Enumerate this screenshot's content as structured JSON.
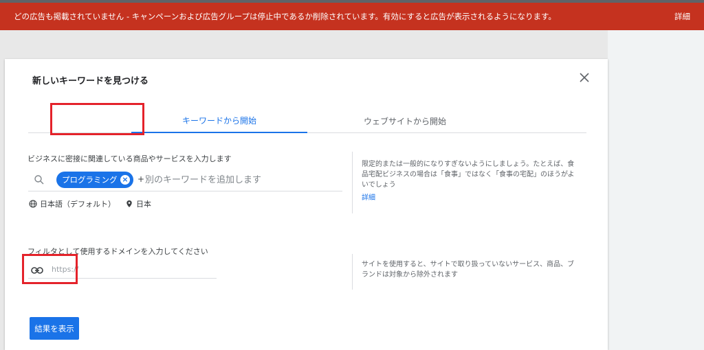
{
  "banner": {
    "message": "どの広告も掲載されていません - キャンペーンおよび広告グループは停止中であるか削除されています。有効にすると広告が表示されるようになります。",
    "details_label": "詳細"
  },
  "dialog": {
    "title": "新しいキーワードを見つける",
    "tabs": [
      {
        "label": "キーワードから開始",
        "active": true
      },
      {
        "label": "ウェブサイトから開始",
        "active": false
      }
    ],
    "keywords": {
      "label": "ビジネスに密接に関連している商品やサービスを入力します",
      "chip": "プログラミング",
      "plus": "+",
      "placeholder": "別のキーワードを追加します",
      "language": "日本語（デフォルト）",
      "location": "日本",
      "help_text": "限定的または一般的になりすぎないようにしましょう。たとえば、食品宅配ビジネスの場合は「食事」ではなく「食事の宅配」のほうがよいでしょう",
      "help_link": "詳細"
    },
    "domain": {
      "label": "フィルタとして使用するドメインを入力してください",
      "placeholder": "https://",
      "help_text": "サイトを使用すると、サイトで取り扱っていないサービス、商品、ブランドは対象から除外されます"
    },
    "submit_label": "結果を表示"
  },
  "colors": {
    "banner": "#c5321f",
    "accent": "#1a73e8",
    "highlight": "#e4222a"
  },
  "icons": [
    "search-icon",
    "close-icon",
    "chip-remove-icon",
    "globe-icon",
    "location-pin-icon",
    "link-icon"
  ]
}
